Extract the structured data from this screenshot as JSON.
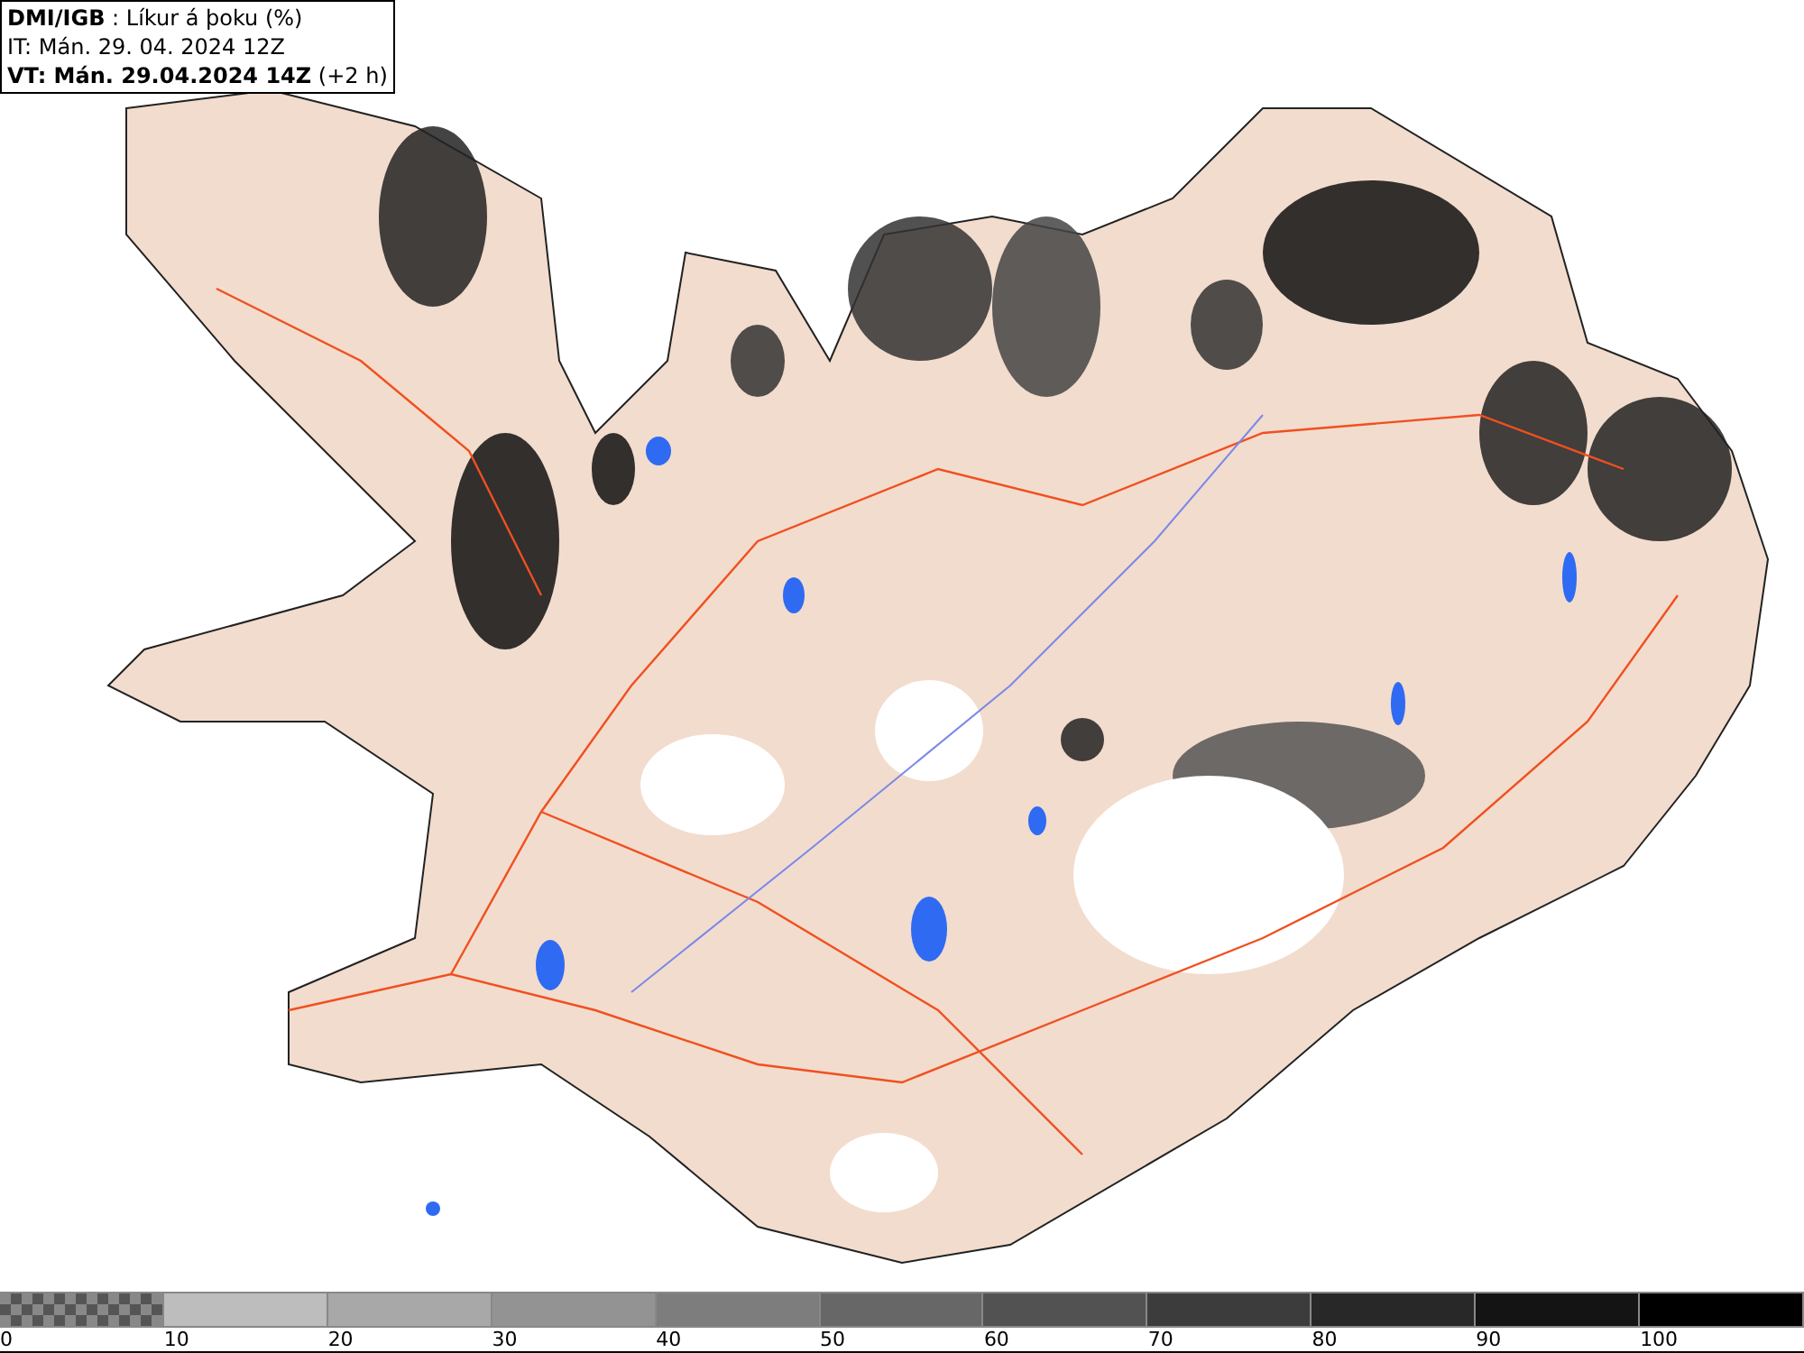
{
  "header": {
    "lines": [
      "**DMI/IGB** : Líkur á þoku (%)",
      "IT: Mán. 29. 04. 2024 12Z",
      "**VT: Mán. 29.04.2024 14Z** (+2 h)"
    ]
  },
  "legend": [
    {
      "label": "0",
      "kind": "checker",
      "color": "#555555"
    },
    {
      "label": "10",
      "kind": "solid",
      "color": "#bdbdbd"
    },
    {
      "label": "20",
      "kind": "solid",
      "color": "#a8a8a8"
    },
    {
      "label": "30",
      "kind": "solid",
      "color": "#939393"
    },
    {
      "label": "40",
      "kind": "solid",
      "color": "#7d7d7d"
    },
    {
      "label": "50",
      "kind": "solid",
      "color": "#676767"
    },
    {
      "label": "60",
      "kind": "solid",
      "color": "#525252"
    },
    {
      "label": "70",
      "kind": "solid",
      "color": "#3c3c3c"
    },
    {
      "label": "80",
      "kind": "solid",
      "color": "#282828"
    },
    {
      "label": "90",
      "kind": "solid",
      "color": "#141414"
    },
    {
      "label": "100",
      "kind": "solid",
      "color": "#000000"
    }
  ]
}
